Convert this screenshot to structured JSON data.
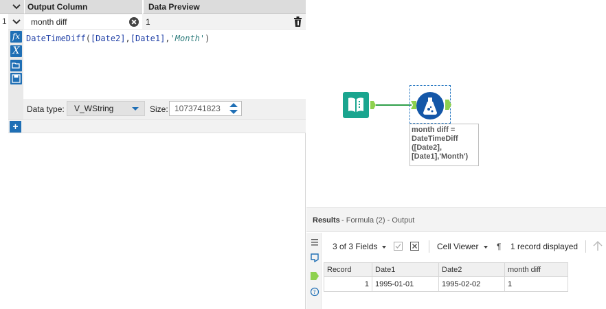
{
  "config": {
    "header": {
      "output_column": "Output Column",
      "data_preview": "Data Preview"
    },
    "row": {
      "number": "1",
      "name": "month diff",
      "preview": "1"
    },
    "expression": {
      "fn": "DateTimeDiff",
      "open": "(",
      "field1": "[Date2]",
      "comma1": ",",
      "field2": "[Date1]",
      "comma2": ",",
      "str": "'Month'",
      "close": ")"
    },
    "tools": {
      "fx": "fx",
      "x": "X"
    },
    "data_type": {
      "label": "Data type:",
      "value": "V_WString"
    },
    "size": {
      "label": "Size:",
      "value": "1073741823"
    },
    "add": "+"
  },
  "canvas": {
    "annotation": "month diff =\nDateTimeDiff\n([Date2],\n[Date1],'Month')"
  },
  "results": {
    "title": "Results",
    "subtitle": "- Formula (2) - Output",
    "fields": "3 of 3 Fields",
    "viewer": "Cell Viewer",
    "pilcrow": "¶",
    "records": "1 record displayed",
    "columns": [
      "Record",
      "Date1",
      "Date2",
      "month diff"
    ],
    "rows": [
      {
        "record": "1",
        "date1": "1995-01-01",
        "date2": "1995-02-02",
        "month_diff": "1"
      }
    ]
  },
  "colors": {
    "accent": "#1f6fb5",
    "input_tool": "#1aa58f",
    "formula_tool": "#1457a8",
    "anchor": "#8ed14e"
  }
}
